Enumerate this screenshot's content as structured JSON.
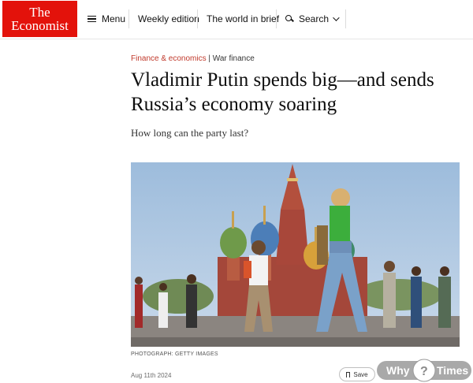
{
  "header": {
    "logo_line1": "The",
    "logo_line2": "Economist",
    "menu_label": "Menu",
    "weekly_edition": "Weekly edition",
    "world_in_brief": "The world in brief",
    "search_label": "Search"
  },
  "article": {
    "section": "Finance & economics",
    "separator": "|",
    "subsection": "War finance",
    "headline": "Vladimir Putin spends big—and sends Russia’s economy soaring",
    "subheadline": "How long can the party last?",
    "photo_credit": "PHOTOGRAPH: GETTY IMAGES",
    "date": "Aug 11th 2024",
    "save_label": "Save"
  },
  "watermark": {
    "text_left": "Why",
    "text_mark": "?",
    "text_right": "Times"
  },
  "colors": {
    "brand_red": "#e3120b",
    "section_red": "#c0392b",
    "sky": "#a9c4e0"
  },
  "icons": [
    "menu-icon",
    "search-icon",
    "chevron-down-icon",
    "bookmark-icon"
  ]
}
